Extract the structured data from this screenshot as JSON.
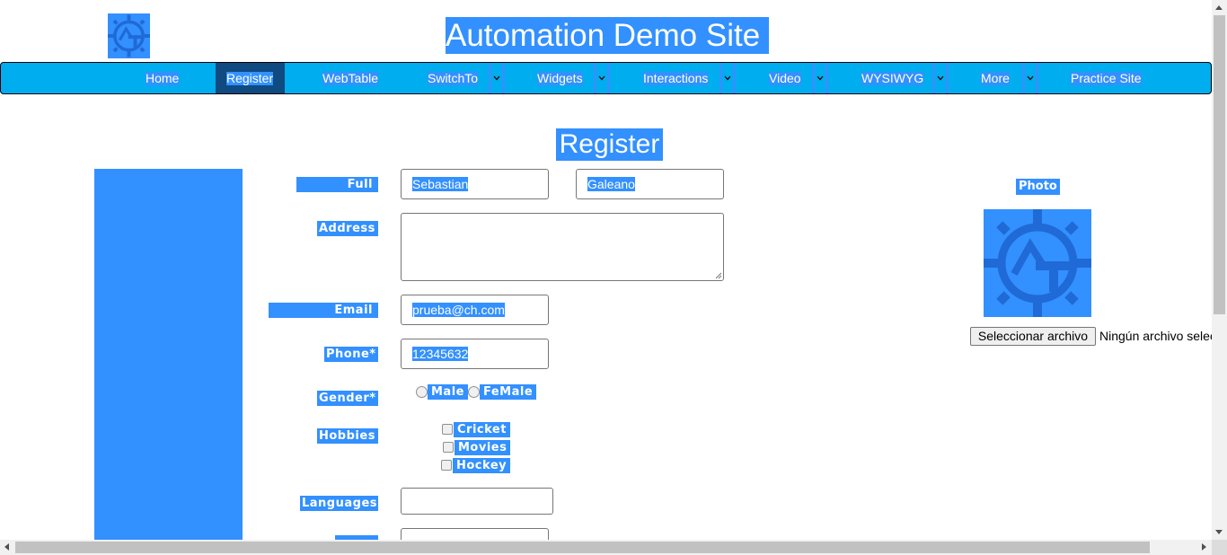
{
  "header": {
    "title": "Automation Demo Site"
  },
  "nav": {
    "home": "Home",
    "register": "Register",
    "webtable": "WebTable",
    "switchto": "SwitchTo",
    "widgets": "Widgets",
    "interactions": "Interactions",
    "video": "Video",
    "wysiwyg": "WYSIWYG",
    "more": "More",
    "practice": "Practice Site"
  },
  "page": {
    "heading": "Register"
  },
  "form": {
    "full_name_label": "Full Name*",
    "first_name": "Sebastian",
    "last_name": "Galeano",
    "address_label": "Address",
    "address_value": "",
    "email_label": "Email address*",
    "email_value": "prueba@ch.com",
    "phone_label": "Phone*",
    "phone_value": "12345632",
    "gender_label": "Gender*",
    "gender_male": "Male",
    "gender_female": "FeMale",
    "hobbies_label": "Hobbies",
    "hobby_cricket": "Cricket",
    "hobby_movies": "Movies",
    "hobby_hockey": "Hockey",
    "languages_label": "Languages",
    "languages_value": ""
  },
  "photo": {
    "label": "Photo",
    "button": "Seleccionar archivo",
    "status": "Ningún archivo seleccionado"
  },
  "colors": {
    "selection": "#3390ff",
    "nav_bg": "#00adef",
    "nav_active": "#0f4a80"
  }
}
